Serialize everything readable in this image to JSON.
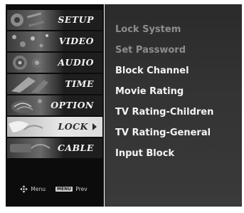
{
  "tabs": [
    {
      "label": "SETUP",
      "icon": "setup-icon",
      "active": false
    },
    {
      "label": "VIDEO",
      "icon": "video-icon",
      "active": false
    },
    {
      "label": "AUDIO",
      "icon": "audio-icon",
      "active": false
    },
    {
      "label": "TIME",
      "icon": "time-icon",
      "active": false
    },
    {
      "label": "OPTION",
      "icon": "option-icon",
      "active": false
    },
    {
      "label": "LOCK",
      "icon": "lock-icon",
      "active": true
    },
    {
      "label": "CABLE",
      "icon": "cable-icon",
      "active": false
    }
  ],
  "hint": {
    "move_label": "Menu",
    "prev_key": "MENU",
    "prev_label": "Prev"
  },
  "menu_items": [
    {
      "label": "Lock System",
      "dimmed": true
    },
    {
      "label": "Set Password",
      "dimmed": true
    },
    {
      "label": "Block Channel",
      "dimmed": false
    },
    {
      "label": "Movie Rating",
      "dimmed": false
    },
    {
      "label": "TV Rating-Children",
      "dimmed": false
    },
    {
      "label": "TV Rating-General",
      "dimmed": false
    },
    {
      "label": "Input Block",
      "dimmed": false
    }
  ],
  "colors": {
    "tab_bg": "#1e1e1e",
    "tab_active_bg": "#dcdcdc",
    "panel_bg": "#333333",
    "text_active": "#f4f4f4",
    "text_dimmed": "#8e8e8e"
  }
}
